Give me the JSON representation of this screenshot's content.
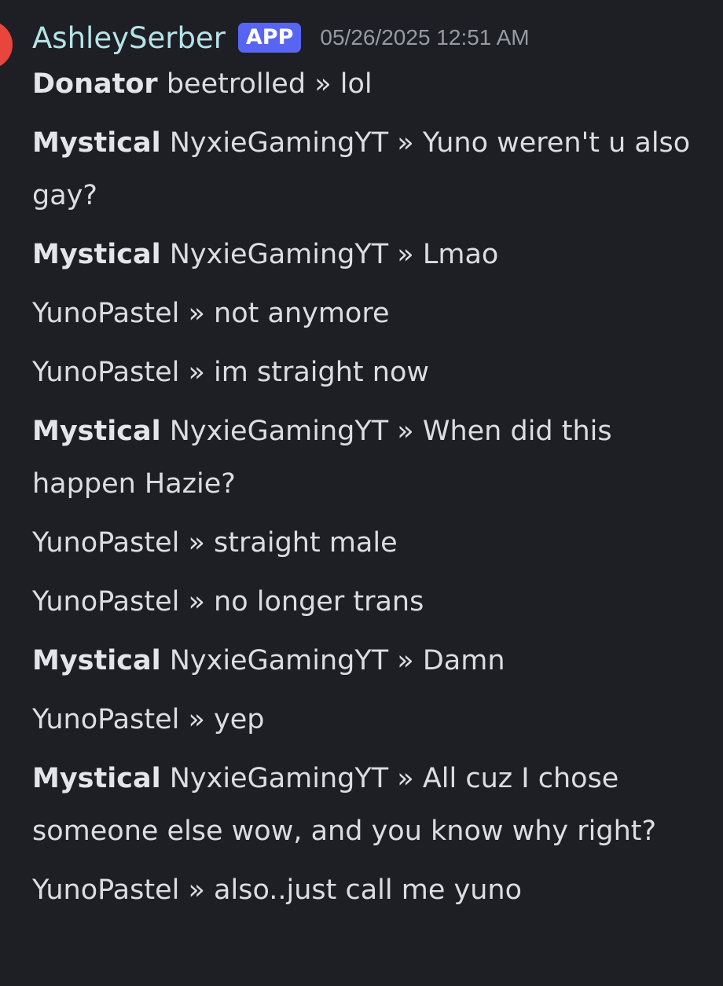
{
  "message": {
    "author": "AshleySerber",
    "badge": "APP",
    "timestamp": "05/26/2025 12:51 AM"
  },
  "lines": [
    {
      "rank": "Donator",
      "player": "beetrolled",
      "sep": "»",
      "text": "lol"
    },
    {
      "rank": "Mystical",
      "player": "NyxieGamingYT",
      "sep": "»",
      "text": "Yuno weren't u also gay?"
    },
    {
      "rank": "Mystical",
      "player": "NyxieGamingYT",
      "sep": "»",
      "text": "Lmao"
    },
    {
      "rank": "",
      "player": "YunoPastel",
      "sep": "»",
      "text": "not anymore"
    },
    {
      "rank": "",
      "player": "YunoPastel",
      "sep": "»",
      "text": "im straight now"
    },
    {
      "rank": "Mystical",
      "player": "NyxieGamingYT",
      "sep": "»",
      "text": "When did this happen Hazie?"
    },
    {
      "rank": "",
      "player": "YunoPastel",
      "sep": "»",
      "text": "straight male"
    },
    {
      "rank": "",
      "player": "YunoPastel",
      "sep": "»",
      "text": "no longer trans"
    },
    {
      "rank": "Mystical",
      "player": "NyxieGamingYT",
      "sep": "»",
      "text": "Damn"
    },
    {
      "rank": "",
      "player": "YunoPastel",
      "sep": "»",
      "text": "yep"
    },
    {
      "rank": "Mystical",
      "player": "NyxieGamingYT",
      "sep": "»",
      "text": "All cuz I chose someone else wow, and you know why right?"
    },
    {
      "rank": "",
      "player": "YunoPastel",
      "sep": "»",
      "text": "also..just call me yuno"
    }
  ],
  "colors": {
    "background": "#1e1f24",
    "author": "#b6e3e8",
    "badge": "#5865f2",
    "timestamp": "#949ba4",
    "text": "#dbdee1",
    "avatar": "#e8453c"
  },
  "icons": {
    "avatar": "avatar-icon"
  }
}
